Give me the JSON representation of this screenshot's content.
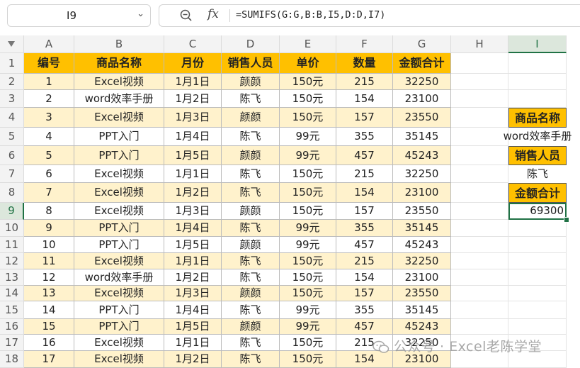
{
  "name_box": {
    "value": "I9"
  },
  "formula_bar": {
    "fx_label": "fx",
    "formula": "=SUMIFS(G:G,B:B,I5,D:D,I7)"
  },
  "columns": [
    "A",
    "B",
    "C",
    "D",
    "E",
    "F",
    "G",
    "H",
    "I"
  ],
  "active_column": "I",
  "active_row": 9,
  "rows": [
    "1",
    "2",
    "3",
    "4",
    "5",
    "6",
    "7",
    "8",
    "9",
    "10",
    "11",
    "12",
    "13",
    "14",
    "15",
    "16",
    "17",
    "18"
  ],
  "table": {
    "headers": [
      "编号",
      "商品名称",
      "月份",
      "销售人员",
      "单价",
      "数量",
      "金额合计"
    ],
    "rows": [
      [
        "1",
        "Excel视频",
        "1月1日",
        "颜颜",
        "150元",
        "215",
        "32250"
      ],
      [
        "2",
        "word效率手册",
        "1月2日",
        "陈飞",
        "150元",
        "154",
        "23100"
      ],
      [
        "3",
        "Excel视频",
        "1月3日",
        "颜颜",
        "150元",
        "157",
        "23550"
      ],
      [
        "4",
        "PPT入门",
        "1月4日",
        "陈飞",
        "99元",
        "355",
        "35145"
      ],
      [
        "5",
        "PPT入门",
        "1月5日",
        "颜颜",
        "99元",
        "457",
        "45243"
      ],
      [
        "6",
        "Excel视频",
        "1月1日",
        "陈飞",
        "150元",
        "215",
        "32250"
      ],
      [
        "7",
        "Excel视频",
        "1月2日",
        "陈飞",
        "150元",
        "154",
        "23100"
      ],
      [
        "8",
        "Excel视频",
        "1月3日",
        "颜颜",
        "150元",
        "157",
        "23550"
      ],
      [
        "9",
        "PPT入门",
        "1月4日",
        "陈飞",
        "99元",
        "355",
        "35145"
      ],
      [
        "10",
        "PPT入门",
        "1月5日",
        "颜颜",
        "99元",
        "457",
        "45243"
      ],
      [
        "11",
        "Excel视频",
        "1月1日",
        "陈飞",
        "150元",
        "215",
        "32250"
      ],
      [
        "12",
        "word效率手册",
        "1月2日",
        "陈飞",
        "150元",
        "154",
        "23100"
      ],
      [
        "13",
        "Excel视频",
        "1月3日",
        "颜颜",
        "150元",
        "157",
        "23550"
      ],
      [
        "14",
        "PPT入门",
        "1月4日",
        "陈飞",
        "99元",
        "355",
        "35145"
      ],
      [
        "15",
        "PPT入门",
        "1月5日",
        "颜颜",
        "99元",
        "457",
        "45243"
      ],
      [
        "16",
        "Excel视频",
        "1月1日",
        "陈飞",
        "150元",
        "215",
        "32250"
      ],
      [
        "17",
        "Excel视频",
        "1月2日",
        "陈飞",
        "150元",
        "154",
        "23100"
      ]
    ]
  },
  "criteria": {
    "product_label": "商品名称",
    "product_value": "word效率手册",
    "salesperson_label": "销售人员",
    "salesperson_value": "陈飞",
    "total_label": "金额合计",
    "total_value": "69300"
  },
  "watermark": {
    "text": "公众号 · Excel老陈学堂"
  },
  "colors": {
    "header_fill": "#ffc000",
    "band_fill": "#fff2cc",
    "selection": "#207245"
  }
}
